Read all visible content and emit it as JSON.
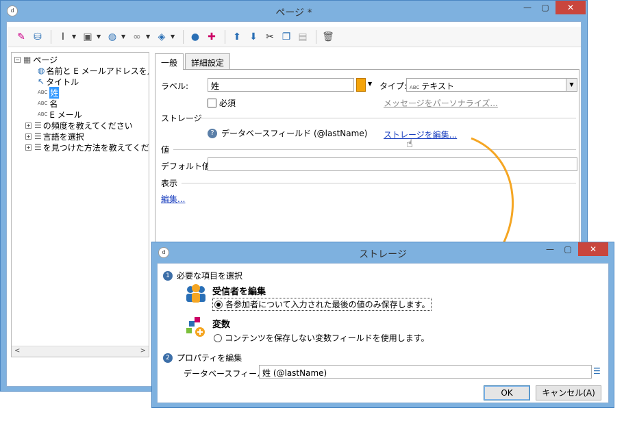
{
  "main_window": {
    "title": "ページ *",
    "min_label": "—",
    "max_label": "▢",
    "close_label": "✕"
  },
  "toolbar": {
    "icons": [
      "wand-icon",
      "database-icon",
      "text-cursor-icon",
      "button-add-icon",
      "globe-icon",
      "link-icon",
      "package-icon",
      "user-icon",
      "add-item-icon",
      "arrow-up-icon",
      "arrow-down-icon",
      "shuffle-icon",
      "copy-icon",
      "paste-icon",
      "delete-icon"
    ]
  },
  "tree": {
    "root_label": "ページ",
    "items": [
      {
        "label": "名前と E メールアドレスを入力"
      },
      {
        "label": "タイトル"
      },
      {
        "prefix": "ABC",
        "label": "姓"
      },
      {
        "prefix": "ABC",
        "label": "名"
      },
      {
        "prefix": "ABC",
        "label": "E メール"
      },
      {
        "label": "の頻度を教えてください"
      },
      {
        "label": "言語を選択"
      },
      {
        "label": "を見つけた方法を教えてください"
      }
    ],
    "expand_symbol": "⊞",
    "collapse_symbol": "⊟",
    "scroll_left": "<",
    "scroll_right": ">"
  },
  "tabs": {
    "general": "一般",
    "advanced": "詳細設定"
  },
  "form": {
    "label_caption": "ラベル:",
    "label_value": "姓",
    "type_caption": "タイプ:",
    "type_prefix": "ABC",
    "type_value": "テキスト",
    "required_label": "必須",
    "personalize_link": "メッセージをパーソナライズ...",
    "storage_section": "ストレージ",
    "storage_field_text": "データベースフィールド (@lastName)",
    "storage_edit_link": "ストレージを編集...",
    "value_section": "値",
    "default_caption": "デフォルト値:",
    "default_value": "",
    "display_section": "表示",
    "display_edit_link": "編集..."
  },
  "dialog": {
    "title": "ストレージ",
    "step1_num": "1",
    "step1_title": "必要な項目を選択",
    "option1_title": "受信者を編集",
    "option1_desc": "各参加者について入力された最後の値のみ保存します。",
    "option2_title": "変数",
    "option2_desc": "コンテンツを保存しない変数フィールドを使用します。",
    "step2_num": "2",
    "step2_title": "プロパティを編集",
    "dbfield_caption": "データベースフィールド:",
    "dbfield_value": "姓 (@lastName)",
    "ok": "OK",
    "cancel": "キャンセル(A)",
    "min_label": "—",
    "max_label": "▢",
    "close_label": "✕"
  },
  "colors": {
    "frame": "#7eb1df",
    "close": "#c9463d",
    "link": "#1a3fbf",
    "arrow": "#f5a623"
  }
}
